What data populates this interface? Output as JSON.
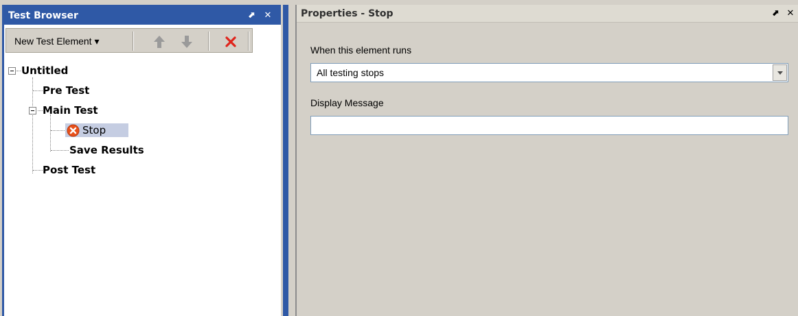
{
  "test_browser": {
    "title": "Test Browser",
    "pin_glyph": "⬈",
    "close_glyph": "✕",
    "toolbar": {
      "new_element_label": "New Test Element ▾",
      "up_icon": "arrow-up-icon",
      "down_icon": "arrow-down-icon",
      "delete_icon": "delete-icon",
      "delete_color": "#e0241b"
    },
    "tree": {
      "root": "Untitled",
      "pre_test": "Pre Test",
      "main_test": "Main Test",
      "stop": "Stop",
      "save_results": "Save Results",
      "post_test": "Post Test"
    }
  },
  "properties": {
    "title": "Properties - Stop",
    "pin_glyph": "⬈",
    "close_glyph": "✕",
    "when_label": "When this element runs",
    "when_value": "All testing stops",
    "message_label": "Display Message",
    "message_value": ""
  },
  "colors": {
    "accent": "#2f59a6",
    "selection": "#c5cde2",
    "stop_icon": "#e8501a"
  }
}
